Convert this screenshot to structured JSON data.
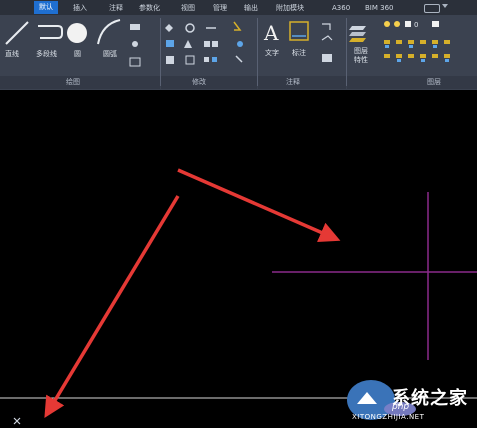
{
  "tabs": [
    {
      "label": "默认",
      "active": true
    },
    {
      "label": "插入"
    },
    {
      "label": "注释"
    },
    {
      "label": "参数化"
    },
    {
      "label": "视图"
    },
    {
      "label": "管理"
    },
    {
      "label": "输出"
    },
    {
      "label": "附加模块"
    },
    {
      "label": "A360"
    },
    {
      "label": "BIM 360"
    }
  ],
  "tools": {
    "line": "直线",
    "polyline": "多段线",
    "circle": "圆",
    "arc": "圆弧",
    "text": "文字",
    "dimension": "标注",
    "layer_props": "图层特性"
  },
  "panels": {
    "draw": "绘图",
    "modify": "修改",
    "annotation": "注释",
    "layers": "图层"
  },
  "watermark": {
    "brand": "系统之家",
    "php": "php",
    "url": "XITONGZHIJIA.NET"
  },
  "colors": {
    "accent": "#1f6fd1",
    "ribbon": "#3b4250",
    "crosshair": "#8a2a8a",
    "arrow": "#e53935"
  }
}
